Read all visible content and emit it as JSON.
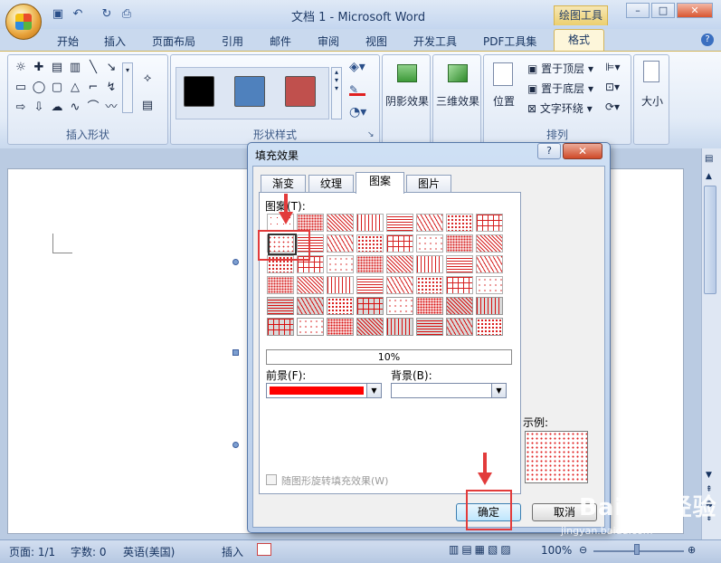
{
  "window": {
    "title": "文档 1 - Microsoft Word",
    "context_tab": "绘图工具",
    "controls": [
      "–",
      "□",
      "✕"
    ]
  },
  "quick_access": [
    "save-icon",
    "undo-icon",
    "redo-icon",
    "print-preview-icon"
  ],
  "tabs": [
    "开始",
    "插入",
    "页面布局",
    "引用",
    "邮件",
    "审阅",
    "视图",
    "开发工具",
    "PDF工具集",
    "格式"
  ],
  "active_tab": "格式",
  "ribbon": {
    "groups": {
      "insert_shapes": "插入形状",
      "shape_styles": "形状样式",
      "arrange": "排列"
    },
    "style_swatch_colors": [
      "#000000",
      "#4f81bd",
      "#c0504d"
    ],
    "shadow_effect": "阴影效果",
    "threed_effect": "三维效果",
    "position": "位置",
    "bring_front": "置于顶层",
    "send_back": "置于底层",
    "text_wrap": "文字环绕",
    "size": "大小"
  },
  "dialog": {
    "title": "填充效果",
    "help": "?",
    "close": "✕",
    "tabs": [
      "渐变",
      "纹理",
      "图案",
      "图片"
    ],
    "active_tab": "图案",
    "pattern_label": "图案(T):",
    "selected_pattern": "10%",
    "foreground_label": "前景(F):",
    "foreground_color": "#ff0000",
    "background_label": "背景(B):",
    "background_color": "#ffffff",
    "sample_label": "示例:",
    "rotate_checkbox": "随图形旋转填充效果(W)",
    "ok": "确定",
    "cancel": "取消"
  },
  "status": {
    "page": "页面: 1/1",
    "words": "字数: 0",
    "language": "英语(美国)",
    "mode": "插入",
    "zoom": "100%"
  },
  "watermark": {
    "brand": "Baidu 经验",
    "url": "jingyan.baidu.com"
  }
}
